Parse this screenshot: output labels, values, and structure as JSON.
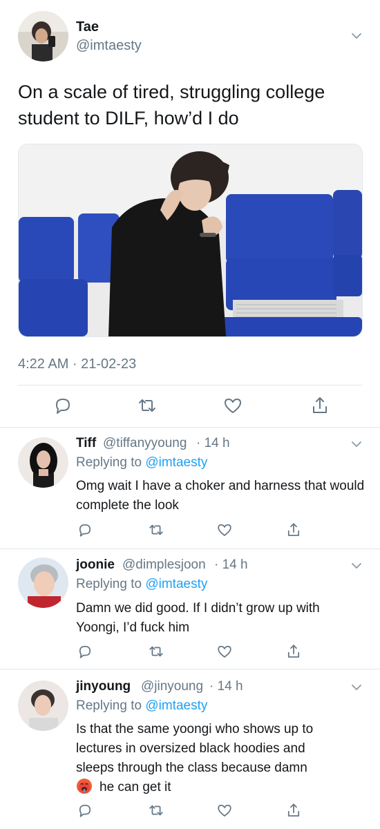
{
  "main_tweet": {
    "author_name": "Tae",
    "author_handle": "@imtaesty",
    "text": "On a scale of tired, struggling college student to DILF, how’d I do",
    "timestamp": "4:22 AM · 21-02-23"
  },
  "actions": [
    "reply-icon",
    "retweet-icon",
    "like-icon",
    "share-icon"
  ],
  "replies": [
    {
      "name": "Tiff",
      "handle": "@tiffanyyoung",
      "time": "· 14 h",
      "replying_prefix": "Replying to",
      "replying_to": "@imtaesty",
      "text": "Omg wait I have a choker and harness that would complete the look"
    },
    {
      "name": "joonie",
      "handle": "@dimplesjoon",
      "time": "· 14 h",
      "replying_prefix": "Replying to",
      "replying_to": "@imtaesty",
      "text": "Damn we did good. If I didn’t grow up with Yoongi, I’d fuck him"
    },
    {
      "name": "jinyoung",
      "handle": "@jinyoung",
      "time": "· 14 h",
      "replying_prefix": "Replying to",
      "replying_to": "@imtaesty",
      "text_lines": [
        "Is that the same yoongi who shows up to",
        "lectures in oversized black hoodies and",
        "sleeps through the class because damn"
      ],
      "emoji": "hot-face-emoji",
      "text_tail": "he can get it"
    }
  ],
  "colors": {
    "text": "#14171a",
    "secondary": "#657786",
    "link": "#1da1f2",
    "divider": "#e1e8ed",
    "seat_blue": "#2a49b8"
  }
}
